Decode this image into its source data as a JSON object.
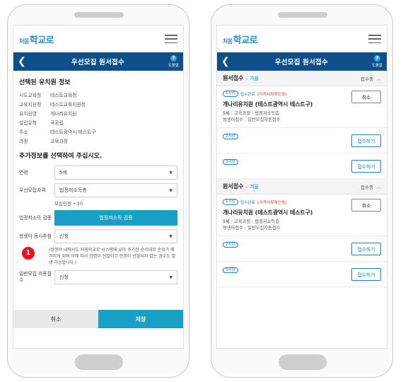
{
  "left": {
    "logo": {
      "small": "처음",
      "big": "학교로"
    },
    "nav": {
      "title": "우선모집 원서접수",
      "help_label": "도움말",
      "help_glyph": "?",
      "back_glyph": "❮"
    },
    "selected_title": "선택된 유치원 정보",
    "info": [
      {
        "key": "시도교육청",
        "value": "테스트교육청"
      },
      {
        "key": "교육지원청",
        "value": "테스트교육지원청"
      },
      {
        "key": "유치원명",
        "value": "개나리유치원"
      },
      {
        "key": "설립유형",
        "value": "국공립"
      },
      {
        "key": "주소",
        "value": "테스트광역시 테스트구"
      },
      {
        "key": "과정",
        "value": "교육과정"
      }
    ],
    "additional_title": "추가정보를 선택하여 주십시오.",
    "fields": {
      "age": {
        "label": "연령",
        "value": "5세"
      },
      "priority": {
        "label": "우선모집자격",
        "value": "법정저소득층"
      },
      "recruit_note": "모집인원 • 10",
      "verify": {
        "label": "법정저소득 검증",
        "button": "법정저소득 검증"
      },
      "sibling": {
        "label": "쌍생아 동시추첨",
        "value": "신청"
      },
      "general": {
        "label": "일반모집 자동접수",
        "value": "신청"
      }
    },
    "badge": "1",
    "notice": "(쌍생아 내에서도 처음학교로 시스템에 유아 추가한 순서대로 순위가 매겨지게 되며 이에 따라 한명이 선발되고 한명이 선발되지 않는 경우도 발생 가능합니다.)",
    "buttons": {
      "cancel": "취소",
      "save": "저장"
    }
  },
  "right": {
    "logo": {
      "small": "처음",
      "big": "학교로"
    },
    "nav": {
      "title": "우선모집 원서접수",
      "help_label": "도움말",
      "help_glyph": "?",
      "back_glyph": "❮"
    },
    "sections": [
      {
        "title": "원서접수",
        "term": "– 가을",
        "status": "접수중",
        "rank1": {
          "tag": "1지망",
          "done": "접수완료",
          "cert": "(자격서류확인중)",
          "school": "개나리유치원 (테스트광역시 테스트구)",
          "age": "5세",
          "course": "교육과정",
          "priority": "법정저소득층",
          "sibling": "쌍생아접수 : 일반모집자동접수",
          "button": "취소"
        },
        "rank2": {
          "tag": "2지망",
          "button": "접수하기"
        },
        "rank3": {
          "tag": "3지망",
          "button": "접수하기"
        }
      },
      {
        "title": "원서접수",
        "term": "– 겨울",
        "status": "접수중",
        "rank1": {
          "tag": "1지망",
          "done": "접수완료",
          "cert": "(자격서류확인중)",
          "school": "개나리유치원 (테스트광역시 테스트구)",
          "age": "5세",
          "course": "교육과정",
          "priority": "법정저소득층",
          "sibling": "쌍생아접수 : 일반모집자동접수",
          "button": "취소"
        },
        "rank2": {
          "tag": "2지망",
          "button": "접수하기"
        },
        "rank3": {
          "tag": "3지망",
          "button": "접수하기"
        }
      }
    ]
  },
  "colors": {
    "nav": "#0d4f8a",
    "accent": "#1aa0c7",
    "badge": "#e8141b"
  }
}
